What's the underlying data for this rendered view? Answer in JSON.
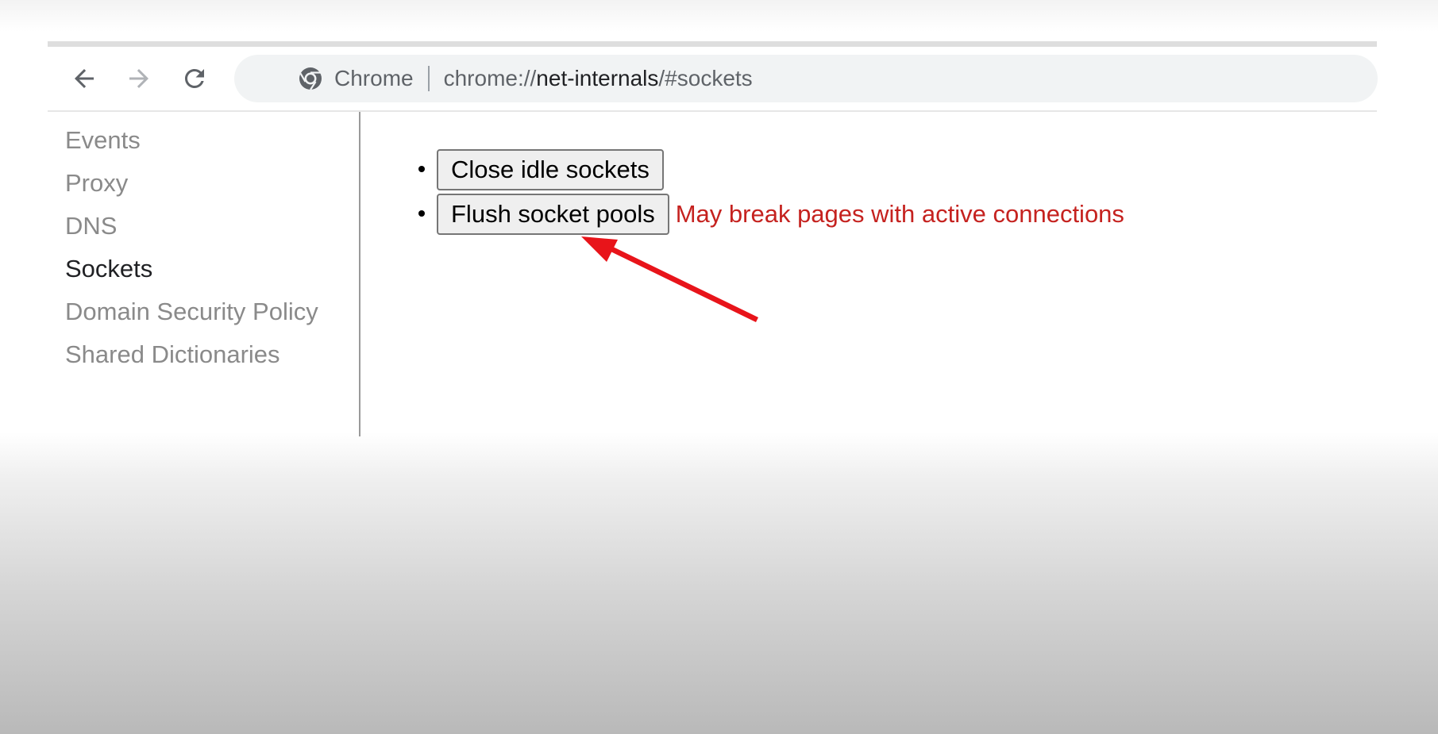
{
  "browser": {
    "chip_label": "Chrome",
    "url_scheme": "chrome://",
    "url_host": "net-internals",
    "url_path": "/#sockets",
    "icons": {
      "back": "arrow-left-icon",
      "forward": "arrow-right-icon",
      "reload": "reload-icon",
      "site": "chrome-logo-icon"
    }
  },
  "sidebar": {
    "items": [
      {
        "label": "Events",
        "active": false
      },
      {
        "label": "Proxy",
        "active": false
      },
      {
        "label": "DNS",
        "active": false
      },
      {
        "label": "Sockets",
        "active": true
      },
      {
        "label": "Domain Security Policy",
        "active": false
      },
      {
        "label": "Shared Dictionaries",
        "active": false
      }
    ]
  },
  "sockets": {
    "close_idle_label": "Close idle sockets",
    "flush_pools_label": "Flush socket pools",
    "flush_warning": "May break pages with active connections"
  },
  "colors": {
    "warning": "#c5221f",
    "annotation_arrow": "#e8141a",
    "active_nav": "#202124",
    "inactive_nav": "#8a8a8a"
  }
}
